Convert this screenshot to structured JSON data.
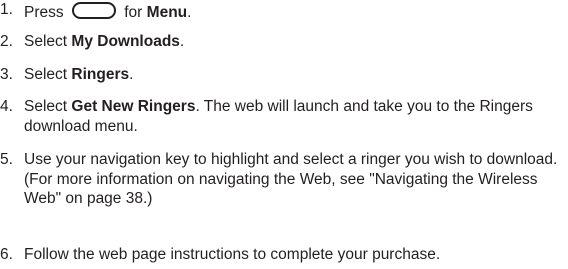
{
  "steps": [
    {
      "number": "1.",
      "pre": "Press",
      "post": "for",
      "bold": "Menu",
      "end": ".",
      "key_icon": "menu-key-icon"
    },
    {
      "number": "2.",
      "pre": "Select",
      "bold": "My Downloads",
      "end": "."
    },
    {
      "number": "3.",
      "pre": "Select",
      "bold": "Ringers",
      "end": "."
    },
    {
      "number": "4.",
      "pre": "Select",
      "bold": "Get New Ringers",
      "end": ". The web will launch and take you to the Ringers download menu."
    },
    {
      "number": "5.",
      "text": "Use your navigation key to highlight and select a ringer you wish to download. (For more information on navigating the Web, see \"Navigating the Wireless Web\" on page 38.)"
    },
    {
      "number": "6.",
      "text": "Follow the web page instructions to complete your purchase."
    }
  ]
}
